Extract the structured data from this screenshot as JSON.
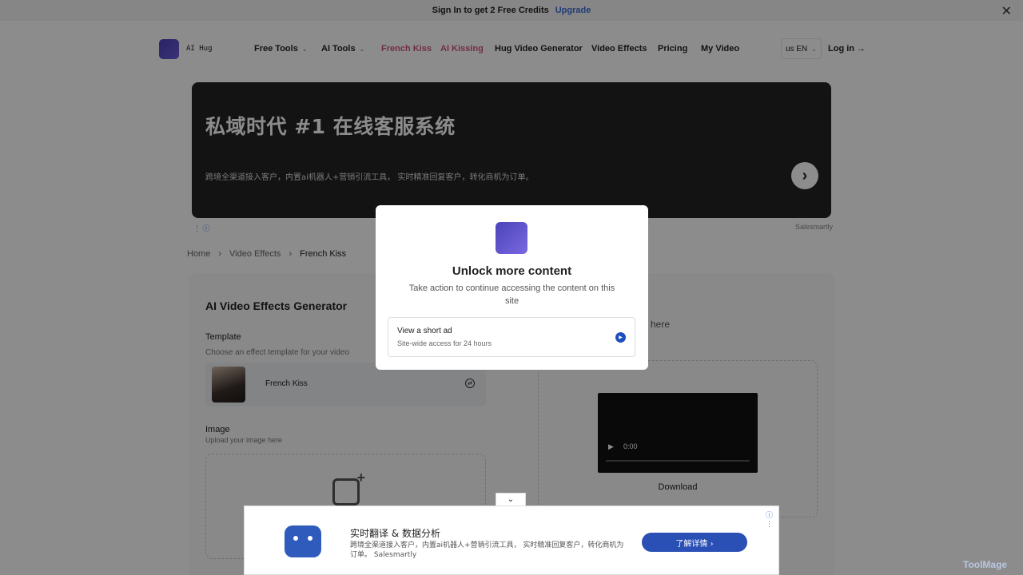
{
  "topbar": {
    "text": "Sign In to get 2 Free Credits",
    "upgrade": "Upgrade",
    "close": "✕"
  },
  "nav": {
    "brand": "AI Hug",
    "items": [
      "Free Tools",
      "AI Tools",
      "French Kiss",
      "AI Kissing",
      "Hug Video Generator",
      "Video Effects",
      "Pricing",
      "My Video"
    ],
    "lang": "us EN",
    "login": "Log in →"
  },
  "ad": {
    "title": "私域时代 #1 在线客服系统",
    "desc": "跨境全渠道接入客户，内置ai机器人+营销引流工具， 实时精准回复客户，转化商机为订单。",
    "source": "Salesmartly",
    "info": "⋮ ⓘ"
  },
  "breadcrumb": [
    "Home",
    "Video Effects",
    "French Kiss"
  ],
  "generator": {
    "title": "AI Video Effects Generator",
    "template_label": "Template",
    "template_hint": "Choose an effect template for your video",
    "template_name": "French Kiss",
    "image_label": "Image",
    "image_hint": "Upload your image here",
    "result_hint": "ar here",
    "video_time": "0:00",
    "download": "Download"
  },
  "modal": {
    "title": "Unlock more content",
    "desc": "Take action to continue accessing the content on this site",
    "option_title": "View a short ad",
    "option_sub": "Site-wide access for 24 hours"
  },
  "bottom_ad": {
    "title": "实时翻译 & 数据分析",
    "desc": "跨境全渠道接入客户，内置ai机器人+营销引流工具， 实时精准回复客户，转化商机为订单。 Salesmartly",
    "button": "了解详情  ›",
    "info": "ⓘ ⋮"
  },
  "watermark": "ToolMage"
}
